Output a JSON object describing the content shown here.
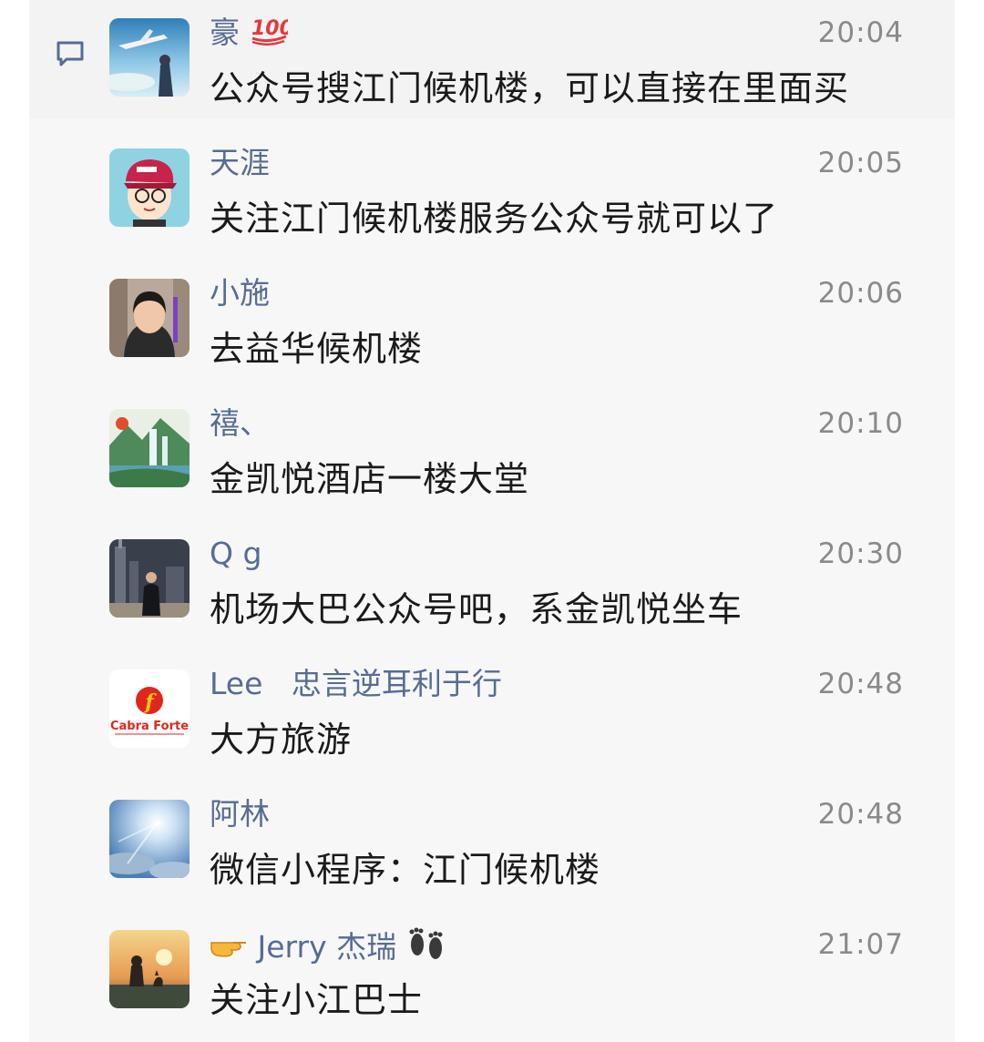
{
  "comments": [
    {
      "name": "豪",
      "name_suffix_emoji": "hundred-points",
      "time": "20:04",
      "text": "公众号搜江门候机楼，可以直接在里面买",
      "avatar": "anime-sky-airplane"
    },
    {
      "name": "天涯",
      "time": "20:05",
      "text": "关注江门候机楼服务公众号就可以了",
      "avatar": "cartoon-boy-red-cap"
    },
    {
      "name": "小施",
      "time": "20:06",
      "text": "去益华候机楼",
      "avatar": "woman-photo"
    },
    {
      "name": "禧、",
      "time": "20:10",
      "text": "金凯悦酒店一楼大堂",
      "avatar": "waterfall-landscape"
    },
    {
      "name": "Q g",
      "time": "20:30",
      "text": "机场大巴公众号吧，系金凯悦坐车",
      "avatar": "man-city-night"
    },
    {
      "name": "Lee   忠言逆耳利于行",
      "time": "20:48",
      "text": "大方旅游",
      "avatar": "cabra-forte-logo",
      "avatar_logo_text": "Cabra Forte"
    },
    {
      "name": "阿林",
      "time": "20:48",
      "text": "微信小程序：江门候机楼",
      "avatar": "sky-sun-clouds"
    },
    {
      "name": "Jerry 杰瑞",
      "name_prefix_emoji": "pointing-hand",
      "name_suffix_emoji": "footprints",
      "time": "21:07",
      "text": "关注小江巴士",
      "avatar": "sunset-cat-painting"
    }
  ],
  "colors": {
    "name": "#576b95",
    "time": "#8a8a8a",
    "text": "#1a1a1a",
    "panel": "#f7f7f7"
  }
}
